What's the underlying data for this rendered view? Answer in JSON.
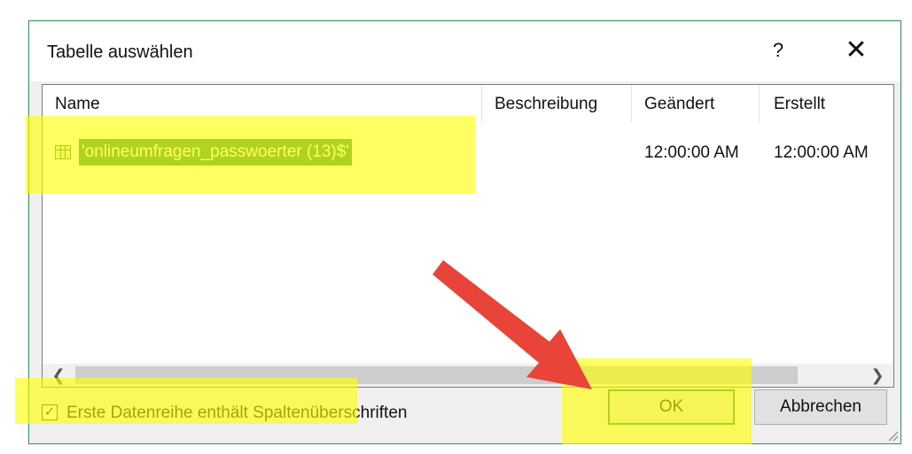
{
  "dialog": {
    "title": "Tabelle auswählen",
    "help_label": "?",
    "close_label": "✕"
  },
  "table": {
    "columns": [
      "Name",
      "Beschreibung",
      "Geändert",
      "Erstellt"
    ],
    "rows": [
      {
        "name": "'onlineumfragen_passwoerter (13)$'",
        "description": "",
        "modified": "12:00:00 AM",
        "created": "12:00:00 AM",
        "icon": "table-icon",
        "selected": true
      }
    ]
  },
  "scrollbar": {
    "left_arrow": "❮",
    "right_arrow": "❯"
  },
  "options": {
    "first_row_headers_label": "Erste Datenreihe enthält Spaltenüberschriften",
    "first_row_headers_checked": true,
    "check_mark": "✓"
  },
  "buttons": {
    "ok_label": "OK",
    "cancel_label": "Abbrechen"
  },
  "annotations": {
    "highlight_color": "#ffff00",
    "arrow_color": "#e8443a",
    "selection_color": "#2f8c55"
  }
}
